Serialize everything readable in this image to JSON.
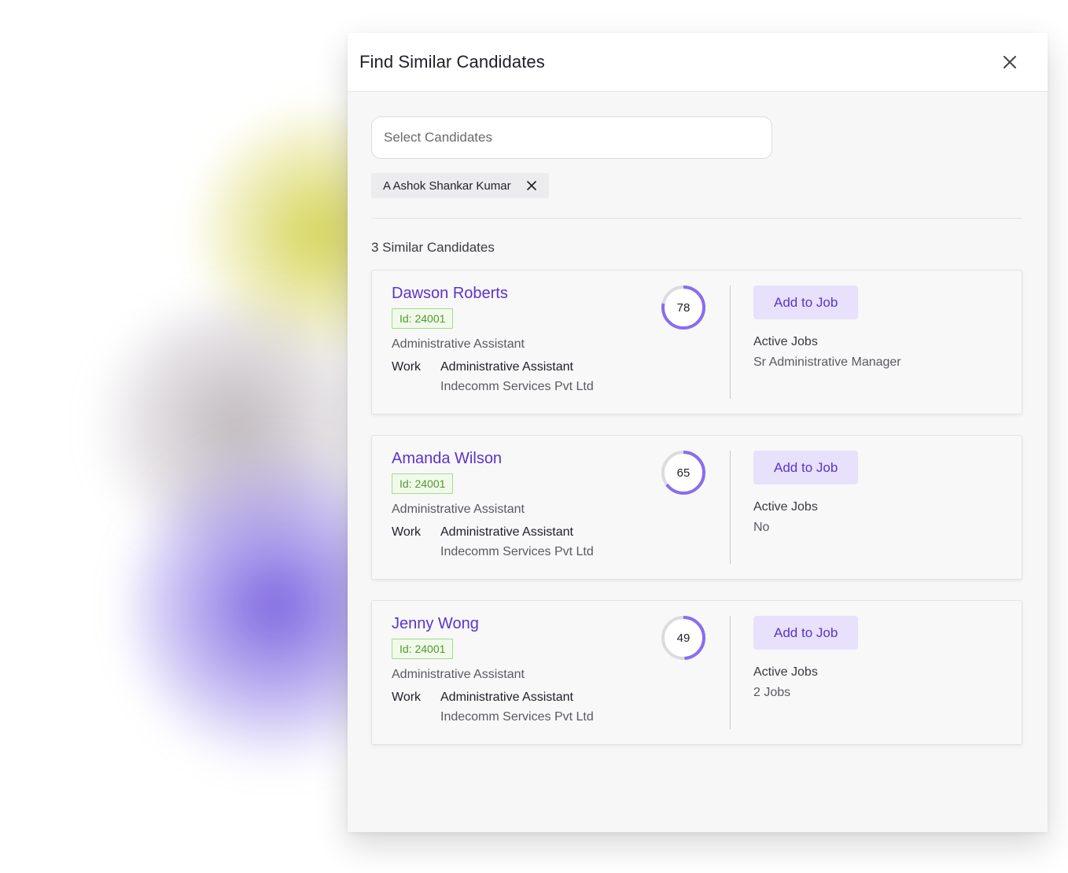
{
  "modal": {
    "title": "Find Similar Candidates"
  },
  "search": {
    "placeholder": "Select Candidates"
  },
  "selected_chip": {
    "label": "A Ashok Shankar Kumar"
  },
  "results": {
    "heading": "3 Similar Candidates"
  },
  "candidates": [
    {
      "name": "Dawson Roberts",
      "id_label": "Id: 24001",
      "role": "Administrative Assistant",
      "work_label": "Work",
      "work_title": "Administrative Assistant",
      "work_company": "Indecomm Services Pvt Ltd",
      "score": 78,
      "add_label": "Add to Job",
      "active_label": "Active Jobs",
      "active_value": "Sr Administrative Manager"
    },
    {
      "name": "Amanda Wilson",
      "id_label": "Id: 24001",
      "role": "Administrative Assistant",
      "work_label": "Work",
      "work_title": "Administrative Assistant",
      "work_company": "Indecomm Services Pvt Ltd",
      "score": 65,
      "add_label": "Add to Job",
      "active_label": "Active Jobs",
      "active_value": "No"
    },
    {
      "name": "Jenny Wong",
      "id_label": "Id: 24001",
      "role": "Administrative Assistant",
      "work_label": "Work",
      "work_title": "Administrative Assistant",
      "work_company": "Indecomm Services Pvt Ltd",
      "score": 49,
      "add_label": "Add to Job",
      "active_label": "Active Jobs",
      "active_value": "2 Jobs"
    }
  ],
  "colors": {
    "accent": "#5a33cc",
    "ring": "#8a6cf0",
    "ring_track": "#dcdcde",
    "id_badge": "#4e9a2c"
  },
  "icons": {
    "close": "close-icon",
    "chip_remove": "close-icon"
  }
}
